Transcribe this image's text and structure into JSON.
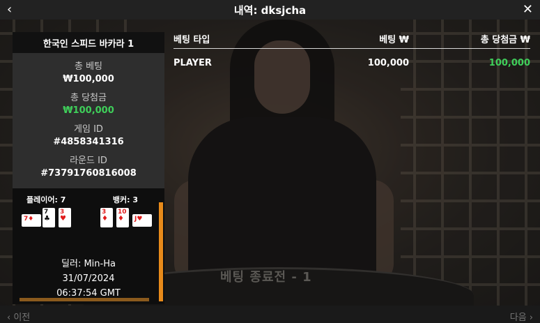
{
  "header": {
    "title": "내역: dksjcha",
    "back_icon": "‹",
    "close_icon": "✕"
  },
  "panel": {
    "title": "한국인 스피드 바카라 1",
    "total_bet_label": "총 베팅",
    "total_bet_value": "₩100,000",
    "total_win_label": "총 당첨금",
    "total_win_value": "₩100,000",
    "game_id_label": "게임 ID",
    "game_id_value": "#4858341316",
    "round_id_label": "라운드 ID",
    "round_id_value": "#73791760816008"
  },
  "result": {
    "player_score": "플레이어: 7",
    "banker_score": "뱅커: 3",
    "player_cards": [
      {
        "rank": "7",
        "suit": "♦",
        "color": "red"
      },
      {
        "rank": "7",
        "suit": "♣",
        "color": "black"
      },
      {
        "rank": "3",
        "suit": "♥",
        "color": "red"
      }
    ],
    "banker_cards": [
      {
        "rank": "3",
        "suit": "♦",
        "color": "red"
      },
      {
        "rank": "10",
        "suit": "♦",
        "color": "red"
      },
      {
        "rank": "J",
        "suit": "♥",
        "color": "red"
      }
    ],
    "dealer": "딜러: Min-Ha",
    "date": "31/07/2024",
    "time": "06:37:54 GMT"
  },
  "bets": {
    "headers": {
      "type": "베팅 타입",
      "bet": "베팅 ₩",
      "win": "총 당첨금 ₩"
    },
    "rows": [
      {
        "type": "PLAYER",
        "bet": "100,000",
        "win": "100,000"
      }
    ]
  },
  "stream": {
    "overlay_text": "베팅 종료전 - 1"
  },
  "footer": {
    "prev": "‹  이전",
    "next": "다음  ›"
  },
  "colors": {
    "accent_green": "#3fcf5a",
    "scroll_orange": "#e78a1a"
  }
}
